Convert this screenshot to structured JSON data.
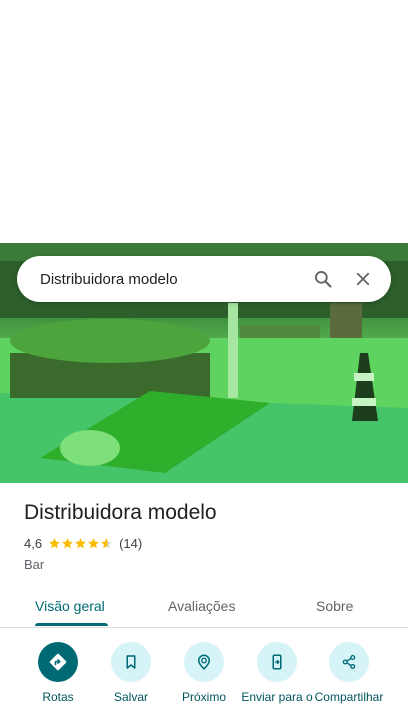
{
  "search": {
    "query": "Distribuidora modelo"
  },
  "place": {
    "name": "Distribuidora modelo",
    "rating": "4,6",
    "rating_value": 4.6,
    "reviews": "(14)",
    "category": "Bar"
  },
  "tabs": [
    {
      "label": "Visão geral",
      "active": true
    },
    {
      "label": "Avaliações",
      "active": false
    },
    {
      "label": "Sobre",
      "active": false
    }
  ],
  "actions": [
    {
      "label": "Rotas",
      "icon": "directions-icon"
    },
    {
      "label": "Salvar",
      "icon": "bookmark-icon"
    },
    {
      "label": "Próximo",
      "icon": "nearby-icon"
    },
    {
      "label": "Enviar para o",
      "icon": "send-to-phone-icon"
    },
    {
      "label": "Compartilhar",
      "icon": "share-icon"
    }
  ],
  "colors": {
    "accent": "#006a74",
    "star": "#fbbc04",
    "chip_bg": "#d6f3f7"
  }
}
